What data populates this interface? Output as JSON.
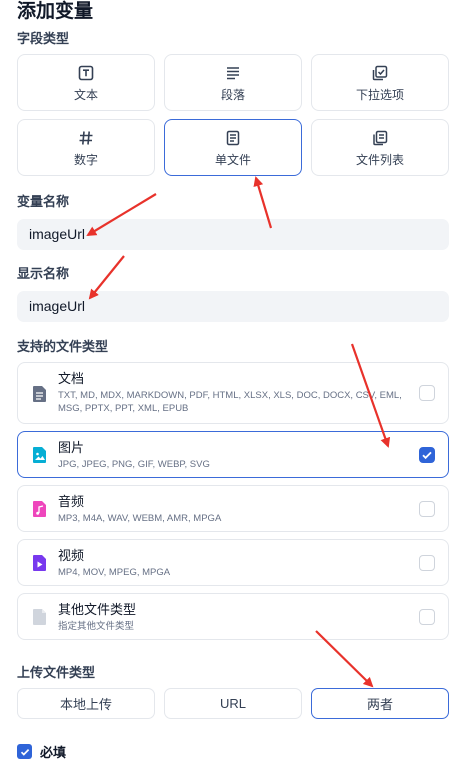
{
  "title": "添加变量",
  "field_type": {
    "label": "字段类型",
    "options": [
      {
        "label": "文本",
        "icon": "text-box-icon"
      },
      {
        "label": "段落",
        "icon": "paragraph-icon"
      },
      {
        "label": "下拉选项",
        "icon": "dropdown-options-icon"
      },
      {
        "label": "数字",
        "icon": "hash-icon"
      },
      {
        "label": "单文件",
        "icon": "file-icon"
      },
      {
        "label": "文件列表",
        "icon": "file-list-icon"
      }
    ],
    "selected": "单文件"
  },
  "variable_name": {
    "label": "变量名称",
    "value": "imageUrl"
  },
  "display_name": {
    "label": "显示名称",
    "value": "imageUrl"
  },
  "file_types": {
    "label": "支持的文件类型",
    "items": [
      {
        "name": "文档",
        "desc": "TXT, MD, MDX, MARKDOWN, PDF, HTML, XLSX, XLS, DOC, DOCX, CSV, EML, MSG, PPTX, PPT, XML, EPUB",
        "icon": "document-icon",
        "color": "#667085",
        "checked": false
      },
      {
        "name": "图片",
        "desc": "JPG, JPEG, PNG, GIF, WEBP, SVG",
        "icon": "image-icon",
        "color": "#06aed4",
        "checked": true
      },
      {
        "name": "音频",
        "desc": "MP3, M4A, WAV, WEBM, AMR, MPGA",
        "icon": "audio-icon",
        "color": "#ee46bc",
        "checked": false
      },
      {
        "name": "视频",
        "desc": "MP4, MOV, MPEG, MPGA",
        "icon": "video-icon",
        "color": "#7839ee",
        "checked": false
      },
      {
        "name": "其他文件类型",
        "desc": "指定其他文件类型",
        "icon": "other-file-icon",
        "color": "#d0d5dd",
        "checked": false
      }
    ]
  },
  "upload_type": {
    "label": "上传文件类型",
    "options": [
      "本地上传",
      "URL",
      "两者"
    ],
    "selected": "两者"
  },
  "required": {
    "label": "必填",
    "checked": true
  },
  "accent_color": "#2f64d8",
  "annotation_color": "#e8322b"
}
